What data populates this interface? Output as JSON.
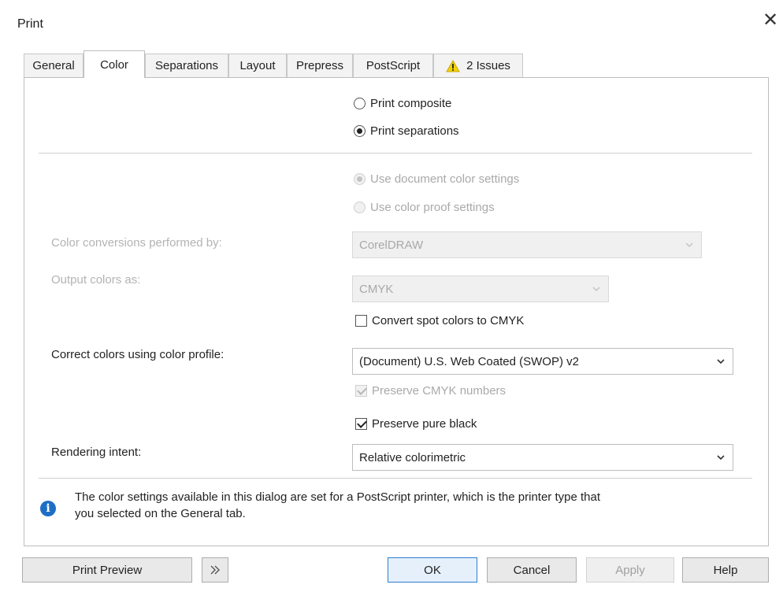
{
  "dialog": {
    "title": "Print",
    "close": "✕"
  },
  "tabs": [
    {
      "label": "General"
    },
    {
      "label": "Color"
    },
    {
      "label": "Separations"
    },
    {
      "label": "Layout"
    },
    {
      "label": "Prepress"
    },
    {
      "label": "PostScript"
    },
    {
      "label": "2 Issues"
    }
  ],
  "output_mode": {
    "composite": "Print composite",
    "separations": "Print separations",
    "selected": "separations"
  },
  "color_settings": {
    "document": "Use document color settings",
    "proof": "Use color proof settings"
  },
  "conversions": {
    "label": "Color conversions performed by:",
    "value": "CorelDRAW"
  },
  "output_colors": {
    "label": "Output colors as:",
    "value": "CMYK"
  },
  "convert_spot": {
    "label": "Convert spot colors to CMYK",
    "checked": false
  },
  "profile": {
    "label": "Correct colors using color profile:",
    "value": "(Document) U.S. Web Coated (SWOP) v2"
  },
  "preserve_cmyk": {
    "label": "Preserve CMYK numbers",
    "checked": true
  },
  "preserve_black": {
    "label": "Preserve pure black",
    "checked": true
  },
  "rendering": {
    "label": "Rendering intent:",
    "value": "Relative colorimetric"
  },
  "info": {
    "line1": "The color settings available in this dialog are set for a PostScript printer, which is the printer type that",
    "line2": "you selected on the General tab."
  },
  "buttons": {
    "print_preview": "Print Preview",
    "ok": "OK",
    "cancel": "Cancel",
    "apply": "Apply",
    "help": "Help"
  },
  "colors": {
    "accent": "#2f7dd1",
    "info": "#1e6ec5",
    "warning": "#f5d300"
  }
}
